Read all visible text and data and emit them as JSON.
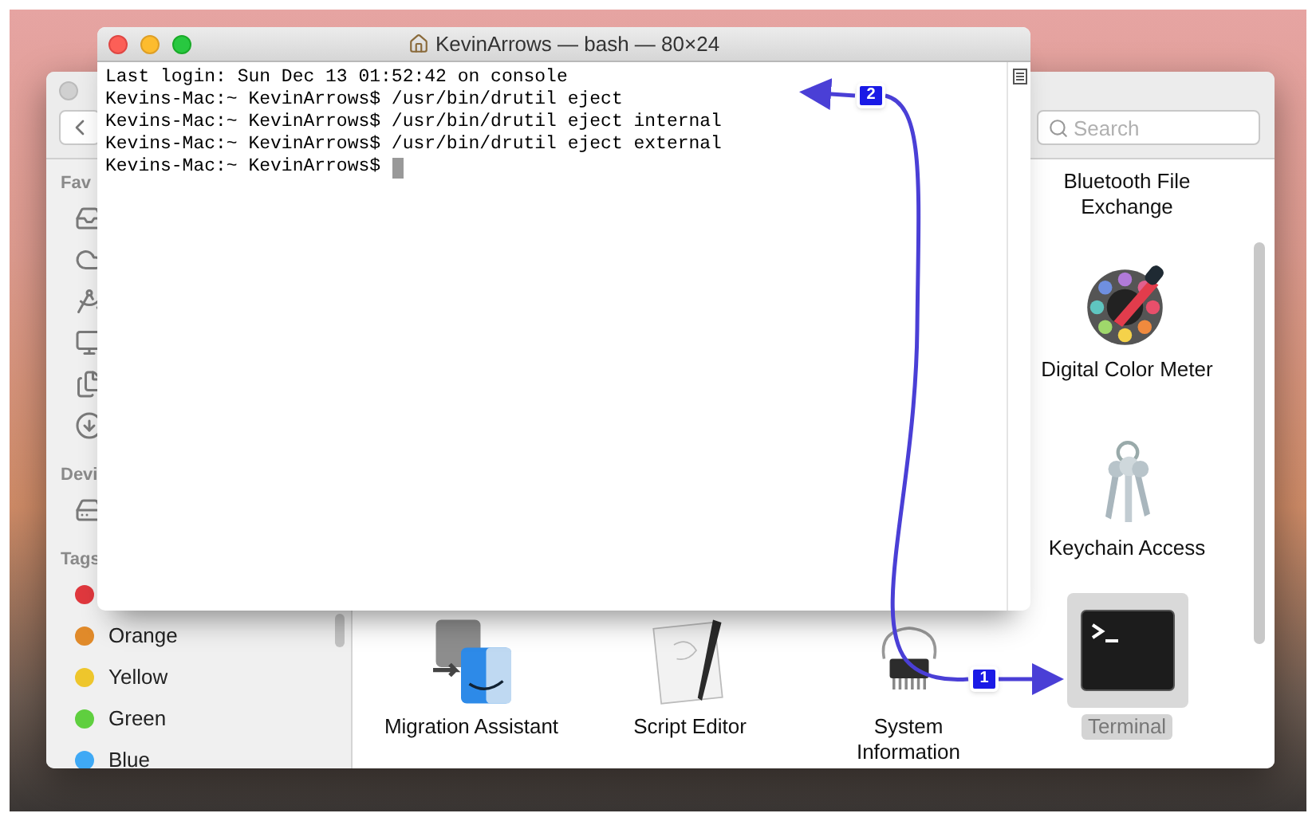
{
  "terminal": {
    "title": "KevinArrows — bash — 80×24",
    "lines": [
      "Last login: Sun Dec 13 01:52:42 on console",
      "Kevins-Mac:~ KevinArrows$ /usr/bin/drutil eject",
      "Kevins-Mac:~ KevinArrows$ /usr/bin/drutil eject internal",
      "Kevins-Mac:~ KevinArrows$ /usr/bin/drutil eject external",
      "Kevins-Mac:~ KevinArrows$"
    ],
    "cursor_visible": true
  },
  "finder": {
    "search": {
      "placeholder": "Search"
    },
    "sidebar": {
      "sections": [
        {
          "header": "Fav",
          "items": [
            {
              "kind": "tray"
            },
            {
              "kind": "cloud"
            },
            {
              "kind": "apps"
            },
            {
              "kind": "desktop"
            },
            {
              "kind": "documents"
            },
            {
              "kind": "downloads"
            }
          ]
        },
        {
          "header": "Devi",
          "items": [
            {
              "kind": "disk"
            }
          ]
        },
        {
          "header": "Tags",
          "items": [
            {
              "kind": "tag",
              "color": "#e0383e"
            },
            {
              "kind": "tag",
              "label": "Orange",
              "color": "#e08a2a"
            },
            {
              "kind": "tag",
              "label": "Yellow",
              "color": "#eec62c"
            },
            {
              "kind": "tag",
              "label": "Green",
              "color": "#5fcf3f"
            },
            {
              "kind": "tag",
              "label": "Blue",
              "color": "#3fa9f5"
            }
          ]
        }
      ]
    },
    "rows": [
      [
        {
          "name": "Bluetooth File Exchange",
          "selected": false
        }
      ],
      [
        {
          "name": "Digital Color Meter",
          "kind": "color-meter",
          "selected": false
        }
      ],
      [
        {
          "name": "Keychain Access",
          "kind": "keychain",
          "selected": false
        }
      ],
      [
        {
          "name": "Migration Assistant",
          "kind": "migration",
          "selected": false
        },
        {
          "name": "Script Editor",
          "kind": "script",
          "selected": false
        },
        {
          "name": "System Information",
          "kind": "sysinfo",
          "selected": false
        },
        {
          "name": "Terminal",
          "kind": "terminal",
          "selected": true
        }
      ]
    ]
  },
  "annotations": [
    {
      "number": "1"
    },
    {
      "number": "2"
    }
  ]
}
